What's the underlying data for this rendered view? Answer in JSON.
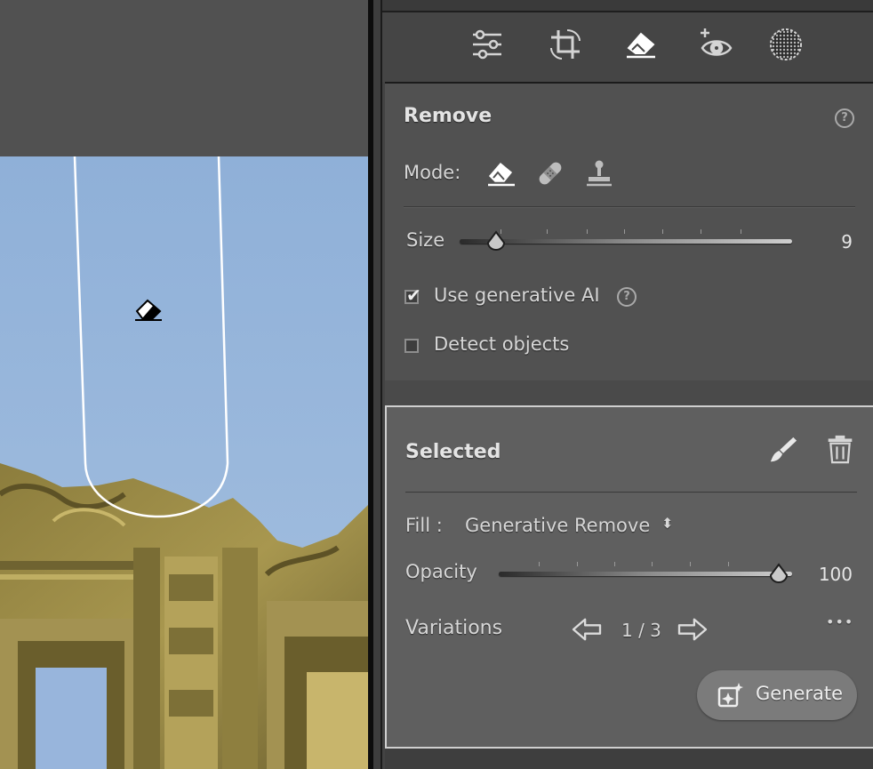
{
  "toolbar": {
    "tools": [
      {
        "icon": "sliders-icon",
        "active": false
      },
      {
        "icon": "crop-icon",
        "active": false
      },
      {
        "icon": "eraser-icon",
        "active": true
      },
      {
        "icon": "red-eye-icon",
        "active": false
      },
      {
        "icon": "masking-icon",
        "active": false
      }
    ]
  },
  "remove": {
    "title": "Remove",
    "help": "?",
    "mode_label": "Mode:",
    "modes": [
      {
        "icon": "eraser-icon",
        "active": true
      },
      {
        "icon": "bandage-icon",
        "active": false
      },
      {
        "icon": "stamp-icon",
        "active": false
      }
    ],
    "size": {
      "label": "Size",
      "value": "9",
      "level": 0.11
    },
    "use_generative_ai": {
      "label": "Use generative AI",
      "checked": true,
      "help": "?"
    },
    "detect_objects": {
      "label": "Detect objects",
      "checked": false
    }
  },
  "selected": {
    "title": "Selected",
    "fill": {
      "label": "Fill :",
      "value": "Generative Remove",
      "chevron": "⬍"
    },
    "opacity": {
      "label": "Opacity",
      "value": "100",
      "level": 1.0
    },
    "variations": {
      "label": "Variations",
      "counter": "1 / 3"
    },
    "more": "•••",
    "generate_label": "Generate"
  },
  "colors": {
    "sky": "#98b6dc",
    "building": "#9e8f4c",
    "accent_outline": "#ffffff"
  }
}
